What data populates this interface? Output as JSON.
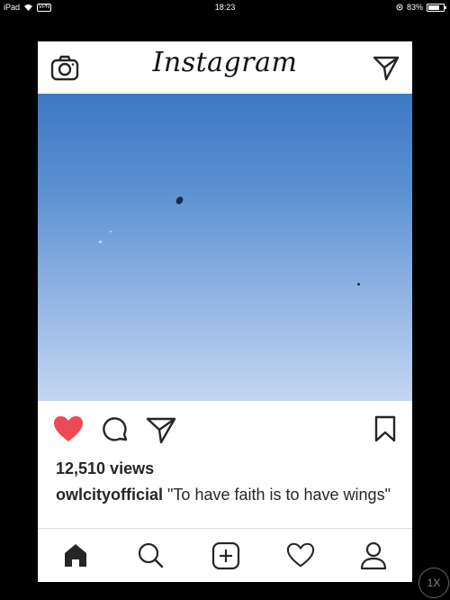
{
  "status_bar": {
    "device": "iPad",
    "vpn": "VPN",
    "time": "18:23",
    "battery_percent_text": "83%",
    "battery_level": 0.83
  },
  "header": {
    "logo_text": "Instagram",
    "left_icon": "camera-icon",
    "right_icon": "direct-send-icon"
  },
  "post": {
    "liked": true,
    "like_color": "#ed4956",
    "views": "12,510 views",
    "caption_user": "owlcityofficial",
    "caption_text": "\"To have faith is to have wings\""
  },
  "tab_bar": {
    "items": [
      "home-icon",
      "search-icon",
      "add-post-icon",
      "activity-heart-icon",
      "profile-icon"
    ]
  },
  "playback_speed": "1X"
}
